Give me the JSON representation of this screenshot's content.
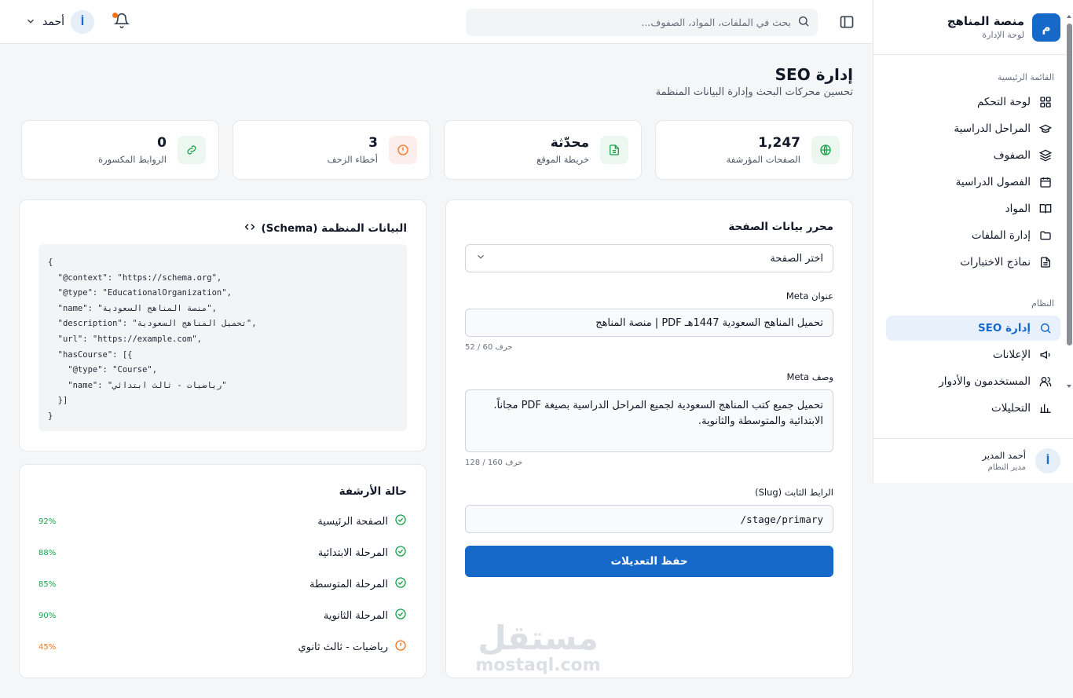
{
  "brand": {
    "logo_letter": "م",
    "title": "منصة المناهج",
    "subtitle": "لوحة الإدارة"
  },
  "sidebar": {
    "section_main": "القائمة الرئيسية",
    "main_items": [
      {
        "label": "لوحة التحكم",
        "icon": "grid-icon"
      },
      {
        "label": "المراحل الدراسية",
        "icon": "graduation-cap-icon"
      },
      {
        "label": "الصفوف",
        "icon": "layers-icon"
      },
      {
        "label": "الفصول الدراسية",
        "icon": "calendar-icon"
      },
      {
        "label": "المواد",
        "icon": "book-open-icon"
      },
      {
        "label": "إدارة الملفات",
        "icon": "folder-icon"
      },
      {
        "label": "نماذج الاختبارات",
        "icon": "file-text-icon"
      }
    ],
    "section_system": "النظام",
    "system_items": [
      {
        "label": "إدارة SEO",
        "icon": "search-icon",
        "active": true
      },
      {
        "label": "الإعلانات",
        "icon": "megaphone-icon"
      },
      {
        "label": "المستخدمون والأدوار",
        "icon": "users-icon"
      },
      {
        "label": "التحليلات",
        "icon": "bar-chart-icon"
      }
    ],
    "user": {
      "avatar": "أ",
      "name": "أحمد المدير",
      "role": "مدير النظام"
    }
  },
  "topbar": {
    "search_placeholder": "بحث في الملفات، المواد، الصفوف...",
    "user_name": "أحمد",
    "user_avatar": "أ"
  },
  "page": {
    "title": "إدارة SEO",
    "subtitle": "تحسين محركات البحث وإدارة البيانات المنظمة"
  },
  "stats": [
    {
      "value": "1,247",
      "label": "الصفحات المؤرشفة",
      "icon": "globe-icon",
      "color": "#16a34a",
      "bg": "#ecf7ef"
    },
    {
      "value": "محدّثة",
      "label": "خريطة الموقع",
      "icon": "file-icon",
      "color": "#16a34a",
      "bg": "#ecf7ef"
    },
    {
      "value": "3",
      "label": "أخطاء الزحف",
      "icon": "alert-icon",
      "color": "#f97316",
      "bg": "#fdeeee"
    },
    {
      "value": "0",
      "label": "الروابط المكسورة",
      "icon": "link-icon",
      "color": "#16a34a",
      "bg": "#ecf7ef"
    }
  ],
  "editor": {
    "title": "محرر بيانات الصفحة",
    "select_value": "اختر الصفحة",
    "meta_title_label": "عنوان Meta",
    "meta_title_value": "تحميل المناهج السعودية 1447هـ PDF | منصة المناهج",
    "meta_title_count": "52 / 60 حرف",
    "meta_desc_label": "وصف Meta",
    "meta_desc_value": "تحميل جميع كتب المناهج السعودية لجميع المراحل الدراسية بصيغة PDF مجاناً. الابتدائية والمتوسطة والثانوية.",
    "meta_desc_count": "128 / 160 حرف",
    "slug_label": "الرابط الثابت (Slug)",
    "slug_value": "/stage/primary",
    "save_label": "حفظ التعديلات"
  },
  "schema": {
    "title": "البيانات المنظمة (Schema)",
    "code": "{\n  \"@context\": \"https://schema.org\",\n  \"@type\": \"EducationalOrganization\",\n  \"name\": \"منصة المناهج السعودية\",\n  \"description\": \"تحميل المناهج السعودية\",\n  \"url\": \"https://example.com\",\n  \"hasCourse\": [{\n    \"@type\": \"Course\",\n    \"name\": \"رياضيات - ثالث ابتدائي\"\n  }]\n}"
  },
  "indexing": {
    "title": "حالة الأرشفة",
    "rows": [
      {
        "label": "الصفحة الرئيسية",
        "percent": "92%",
        "status": "ok"
      },
      {
        "label": "المرحلة الابتدائية",
        "percent": "88%",
        "status": "ok"
      },
      {
        "label": "المرحلة المتوسطة",
        "percent": "85%",
        "status": "ok"
      },
      {
        "label": "المرحلة الثانوية",
        "percent": "90%",
        "status": "ok"
      },
      {
        "label": "رياضيات - ثالث ثانوي",
        "percent": "45%",
        "status": "warn"
      }
    ]
  },
  "colors": {
    "primary": "#1769c9",
    "ok": "#16a34a",
    "warn": "#f97316"
  },
  "watermark": {
    "ar": "مستقل",
    "en": "mostaql.com"
  }
}
